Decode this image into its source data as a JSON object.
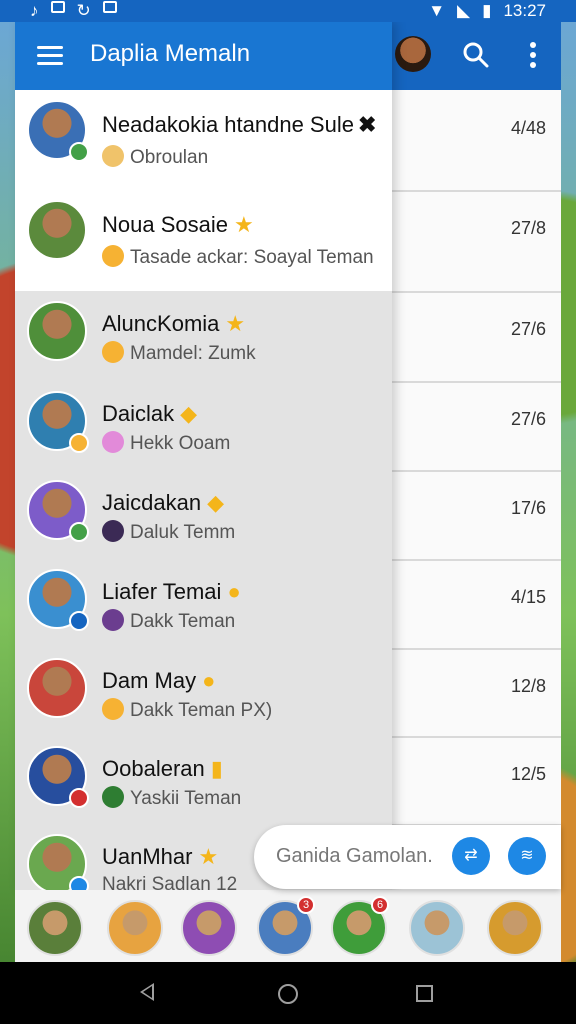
{
  "status_bar": {
    "time": "13:27",
    "left_icons": [
      "music-note-icon",
      "image-icon",
      "refresh-icon",
      "play-icon"
    ],
    "right_icons": [
      "wifi-icon",
      "signal-icon",
      "battery-icon"
    ]
  },
  "drawer": {
    "title": "Daplia Memaln",
    "contacts": [
      {
        "name": "Neadakokia htandne Sule",
        "suffix": "✖",
        "subtitle": "Obroulan",
        "time": "4/48",
        "avatar_color": "#3a6fb5",
        "badge_color": "#43a047",
        "emoji_color": "#f0c36a"
      },
      {
        "name": "Noua Sosaie",
        "suffix": "★",
        "subtitle": "Tasade ackar: Soayal Teman",
        "time": "27/8",
        "avatar_color": "#5b8a3c",
        "badge_color": "",
        "emoji_color": "#f6b233"
      },
      {
        "name": "AluncKomia",
        "suffix": "★",
        "subtitle": "Mamdel: Zumk",
        "time": "27/6",
        "avatar_color": "#4f8f3a",
        "badge_color": "",
        "emoji_color": "#f6b233"
      },
      {
        "name": "Daiclak",
        "suffix": "◆",
        "subtitle": "Hekk Ooam",
        "time": "27/6",
        "avatar_color": "#2f7fb0",
        "badge_color": "#f6b233",
        "emoji_color": "#e28ad9"
      },
      {
        "name": "Jaicdakan",
        "suffix": "◆",
        "subtitle": "Daluk Temm",
        "time": "17/6",
        "avatar_color": "#7d5cc9",
        "badge_color": "#43a047",
        "emoji_color": "#3b2a55"
      },
      {
        "name": "Liafer Temai",
        "suffix": "●",
        "subtitle": "Dakk Teman",
        "time": "4/15",
        "avatar_color": "#3a8fd0",
        "badge_color": "#1565c0",
        "emoji_color": "#6b3d8f"
      },
      {
        "name": "Dam May",
        "suffix": "●",
        "subtitle": "Dakk Teman  PX)",
        "time": "12/8",
        "avatar_color": "#c9463b",
        "badge_color": "",
        "emoji_color": "#f6b233"
      },
      {
        "name": "Oobaleran",
        "suffix": "▮",
        "subtitle": "Yaskii Teman",
        "time": "12/5",
        "avatar_color": "#274e9e",
        "badge_color": "#d32f2f",
        "emoji_color": "#2e7d32"
      },
      {
        "name": "UanMhar",
        "suffix": "★",
        "subtitle": "Nakri Sadlan   12",
        "time": "",
        "avatar_color": "#6aa84f",
        "badge_color": "#1e88e5",
        "emoji_color": ""
      }
    ]
  },
  "composer": {
    "placeholder": "Ganida Gamolan.",
    "button1": "⇄",
    "button2": "≋"
  },
  "strip": [
    {
      "color": "#5a7f3a",
      "badge": false
    },
    {
      "color": "#e7a340",
      "badge": false
    },
    {
      "color": "#8e4db3",
      "badge": false
    },
    {
      "color": "#4a7dbf",
      "badge": true,
      "badge_text": "3"
    },
    {
      "color": "#3f9d3a",
      "badge": true,
      "badge_text": "6"
    },
    {
      "color": "#9cc3d6",
      "badge": false
    },
    {
      "color": "#d69b2e",
      "badge": false
    }
  ]
}
